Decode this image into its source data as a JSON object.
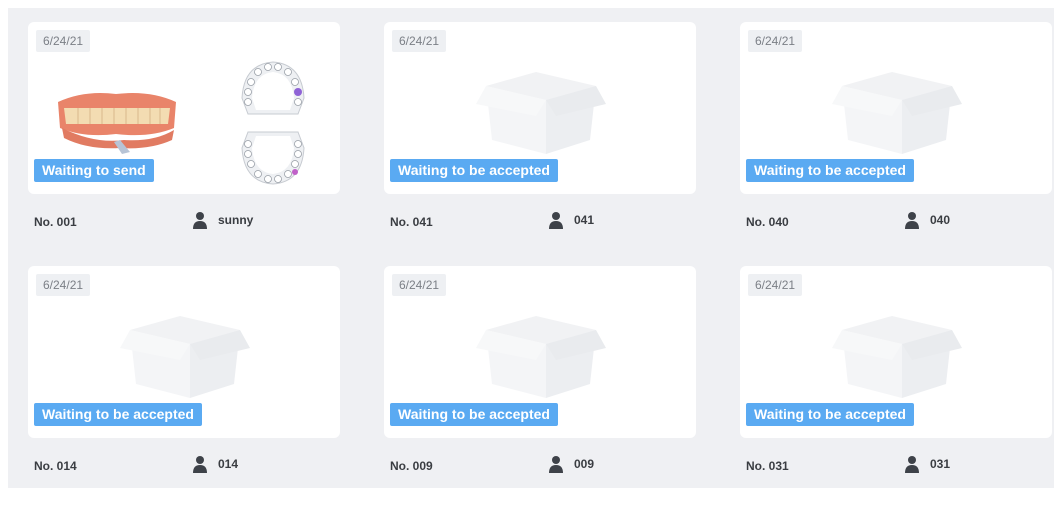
{
  "cards": [
    {
      "date": "6/24/21",
      "status": "Waiting to send",
      "order_no": "No. 001",
      "patient": "sunny"
    },
    {
      "date": "6/24/21",
      "status": "Waiting to be accepted",
      "order_no": "No. 041",
      "patient": "041"
    },
    {
      "date": "6/24/21",
      "status": "Waiting to be accepted",
      "order_no": "No. 040",
      "patient": "040"
    },
    {
      "date": "6/24/21",
      "status": "Waiting to be accepted",
      "order_no": "No. 014",
      "patient": "014"
    },
    {
      "date": "6/24/21",
      "status": "Waiting to be accepted",
      "order_no": "No. 009",
      "patient": "009"
    },
    {
      "date": "6/24/21",
      "status": "Waiting to be accepted",
      "order_no": "No. 031",
      "patient": "031"
    }
  ],
  "colors": {
    "status_badge": "#5aaaf2",
    "panel_background": "#eff0f3",
    "card_background": "#ffffff",
    "text": "#3a3d42"
  },
  "icons": {
    "patient": "person-icon",
    "placeholder": "empty-box-icon",
    "scan_preview": "dental-scan-preview",
    "tooth_chart": "tooth-chart-diagram"
  }
}
